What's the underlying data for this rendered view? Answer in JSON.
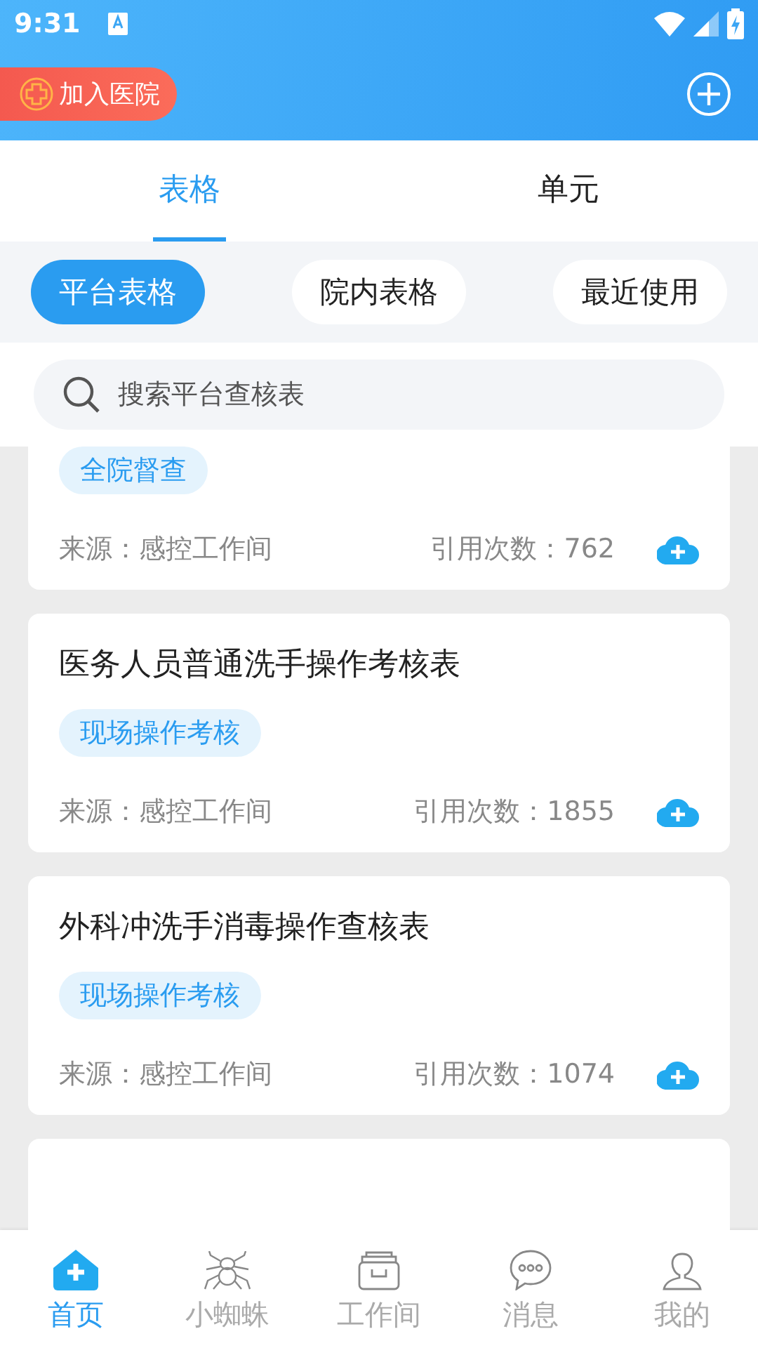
{
  "status_bar": {
    "time": "9:31"
  },
  "header": {
    "join_button": "加入医院"
  },
  "tabs": [
    {
      "label": "表格",
      "selected": true
    },
    {
      "label": "单元",
      "selected": false
    }
  ],
  "filters": [
    {
      "label": "平台表格",
      "selected": true
    },
    {
      "label": "院内表格",
      "selected": false
    },
    {
      "label": "最近使用",
      "selected": false
    }
  ],
  "search": {
    "placeholder": "搜索平台查核表"
  },
  "cards": [
    {
      "kind": "partial",
      "tag": "全院督查",
      "source": "来源：感控工作间",
      "count": "引用次数：762"
    },
    {
      "kind": "full",
      "title": "医务人员普通洗手操作考核表",
      "tag": "现场操作考核",
      "source": "来源：感控工作间",
      "count": "引用次数：1855"
    },
    {
      "kind": "full",
      "title": "外科冲洗手消毒操作查核表",
      "tag": "现场操作考核",
      "source": "来源：感控工作间",
      "count": "引用次数：1074"
    },
    {
      "kind": "cut"
    }
  ],
  "bottom_nav": [
    {
      "label": "首页",
      "selected": true
    },
    {
      "label": "小蜘蛛",
      "selected": false
    },
    {
      "label": "工作间",
      "selected": false
    },
    {
      "label": "消息",
      "selected": false
    },
    {
      "label": "我的",
      "selected": false
    }
  ]
}
